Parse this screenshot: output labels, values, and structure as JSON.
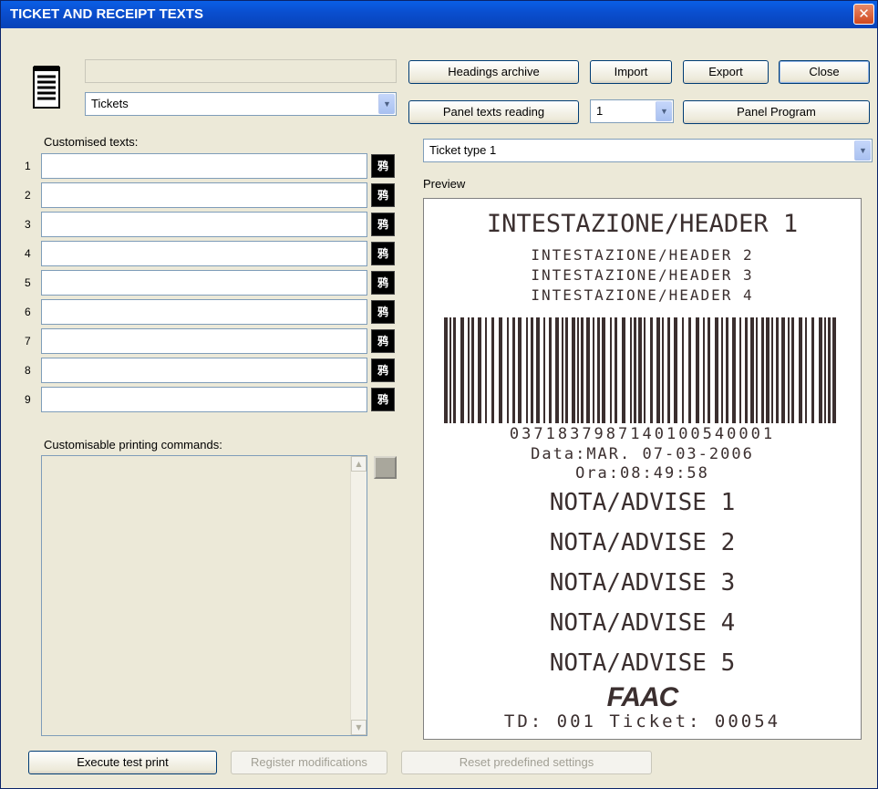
{
  "window": {
    "title": "TICKET AND RECEIPT TEXTS",
    "close_glyph": "✕"
  },
  "top": {
    "name_field_value": "",
    "category_select": "Tickets",
    "buttons": {
      "headings_archive": "Headings archive",
      "import": "Import",
      "export": "Export",
      "close": "Close",
      "panel_texts_reading": "Panel texts reading",
      "panel_program": "Panel Program"
    },
    "panel_number_select": "1",
    "ticket_type_select": "Ticket type 1"
  },
  "customised": {
    "label": "Customised texts:",
    "rows": [
      {
        "num": "1",
        "value": ""
      },
      {
        "num": "2",
        "value": ""
      },
      {
        "num": "3",
        "value": ""
      },
      {
        "num": "4",
        "value": ""
      },
      {
        "num": "5",
        "value": ""
      },
      {
        "num": "6",
        "value": ""
      },
      {
        "num": "7",
        "value": ""
      },
      {
        "num": "8",
        "value": ""
      },
      {
        "num": "9",
        "value": ""
      }
    ],
    "font_glyph": "鸦"
  },
  "commands": {
    "label": "Customisable printing commands:",
    "value": ""
  },
  "preview": {
    "label": "Preview",
    "headers": [
      "INTESTAZIONE/HEADER 1",
      "INTESTAZIONE/HEADER 2",
      "INTESTAZIONE/HEADER 3",
      "INTESTAZIONE/HEADER 4"
    ],
    "barcode_number": "0371837987140100540001",
    "date_line": "Data:MAR. 07-03-2006",
    "time_line": "Ora:08:49:58",
    "notes": [
      "NOTA/ADVISE 1",
      "NOTA/ADVISE 2",
      "NOTA/ADVISE 3",
      "NOTA/ADVISE 4",
      "NOTA/ADVISE 5"
    ],
    "logo": "FAAC",
    "footer": "TD: 001 Ticket: 00054"
  },
  "bottom": {
    "execute_test_print": "Execute test print",
    "register_modifications": "Register modifications",
    "reset_predefined": "Reset predefined settings"
  },
  "icons": {
    "document": "notepad-icon",
    "combo_arrow": "chevron-down-icon",
    "combo_arrow_glyph": "▼"
  },
  "colors": {
    "title_bar": "#0a4fd0",
    "close_button": "#d0481e",
    "dialog_bg": "#ece9d8",
    "print_ink": "#3b2f2f"
  }
}
